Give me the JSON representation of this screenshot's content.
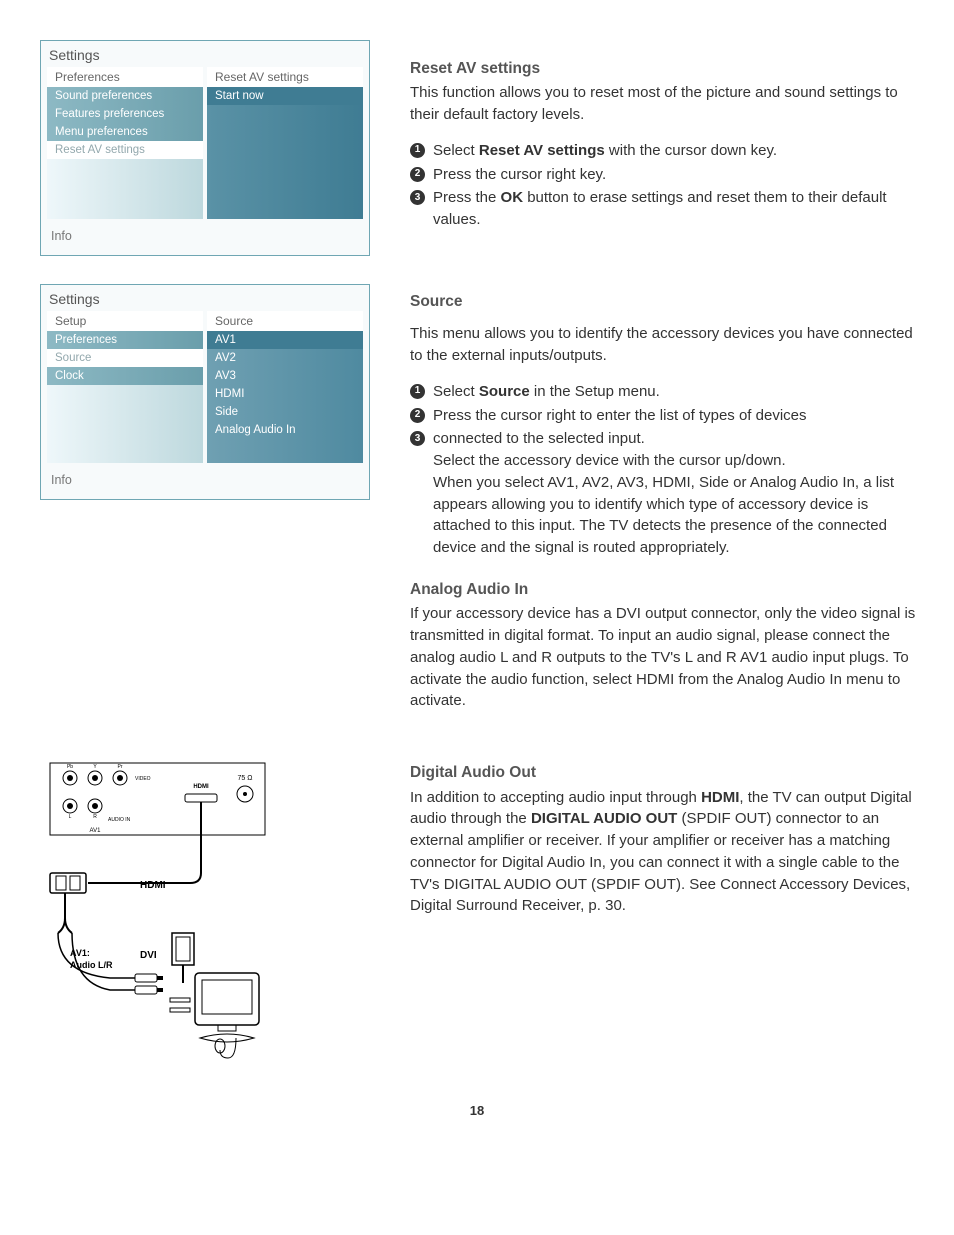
{
  "panel1": {
    "title": "Settings",
    "left_header": "Preferences",
    "right_header": "Reset AV settings",
    "left_items": [
      "Sound preferences",
      "Features preferences",
      "Menu preferences",
      "Reset AV settings"
    ],
    "right_items": [
      "Start now"
    ],
    "footer": "Info"
  },
  "panel2": {
    "title": "Settings",
    "left_header": "Setup",
    "right_header": "Source",
    "left_items": [
      "Preferences",
      "Source",
      "Clock"
    ],
    "right_items": [
      "AV1",
      "AV2",
      "AV3",
      "HDMI",
      "Side",
      "Analog Audio In"
    ],
    "footer": "Info"
  },
  "diagram": {
    "video": "VIDEO",
    "audio_in": "AUDIO IN",
    "av1_label": "AV1",
    "hdmi_top": "HDMI",
    "ohm": "75 Ω",
    "hdmi": "HDMI",
    "dvi": "DVI",
    "av1_audio": "AV1:\nAudio L/R",
    "pb": "Pb",
    "y": "Y",
    "pr": "Pr",
    "l": "L",
    "r": "R"
  },
  "content": {
    "h1": "Reset AV settings",
    "p1": "This function allows you to reset most of the picture and sound settings to their default factory levels.",
    "s1a": "Select ",
    "s1b": "Reset AV settings",
    "s1c": " with the cursor down key.",
    "s2": "Press the cursor right key.",
    "s3a": "Press the ",
    "s3b": "OK",
    "s3c": " button to erase settings and reset them to their default values.",
    "h2": "Source",
    "p2": "This menu allows you to identify the accessory devices you have connected to the external inputs/outputs.",
    "t1a": "Select ",
    "t1b": "Source",
    "t1c": " in the Setup menu.",
    "t2": "Press the cursor right to enter the list of types of devices",
    "t3": "connected to the selected input.",
    "t3b": "Select the accessory device with the cursor up/down.",
    "t3c": "When you select AV1, AV2, AV3, HDMI, Side or Analog Audio In, a list appears allowing you to identify which type of accessory device is attached to this input. The TV detects the presence of the connected device and the signal is routed appropriately.",
    "h3": "Analog Audio In",
    "p3": "If your accessory device has a DVI output connector, only the video signal is transmitted in digital format.  To input an audio signal, please connect the analog audio L and R outputs to the TV's L and R AV1 audio input plugs.  To activate the audio function, select  HDMI from the Analog Audio In menu to activate.",
    "h4": "Digital Audio Out",
    "p4a": "In addition to accepting audio input through ",
    "p4b": "HDMI",
    "p4c": ", the TV can output Digital audio through the ",
    "p4d": "DIGITAL AUDIO OUT",
    "p4e": " (SPDIF OUT) connector to an external amplifier or receiver. If your amplifier or receiver has a matching connector for Digital Audio In, you can connect it with a single cable to the TV's DIGITAL AUDIO OUT (SPDIF OUT). See Connect Accessory Devices, Digital Surround Receiver, p. 30."
  },
  "page_number": "18"
}
